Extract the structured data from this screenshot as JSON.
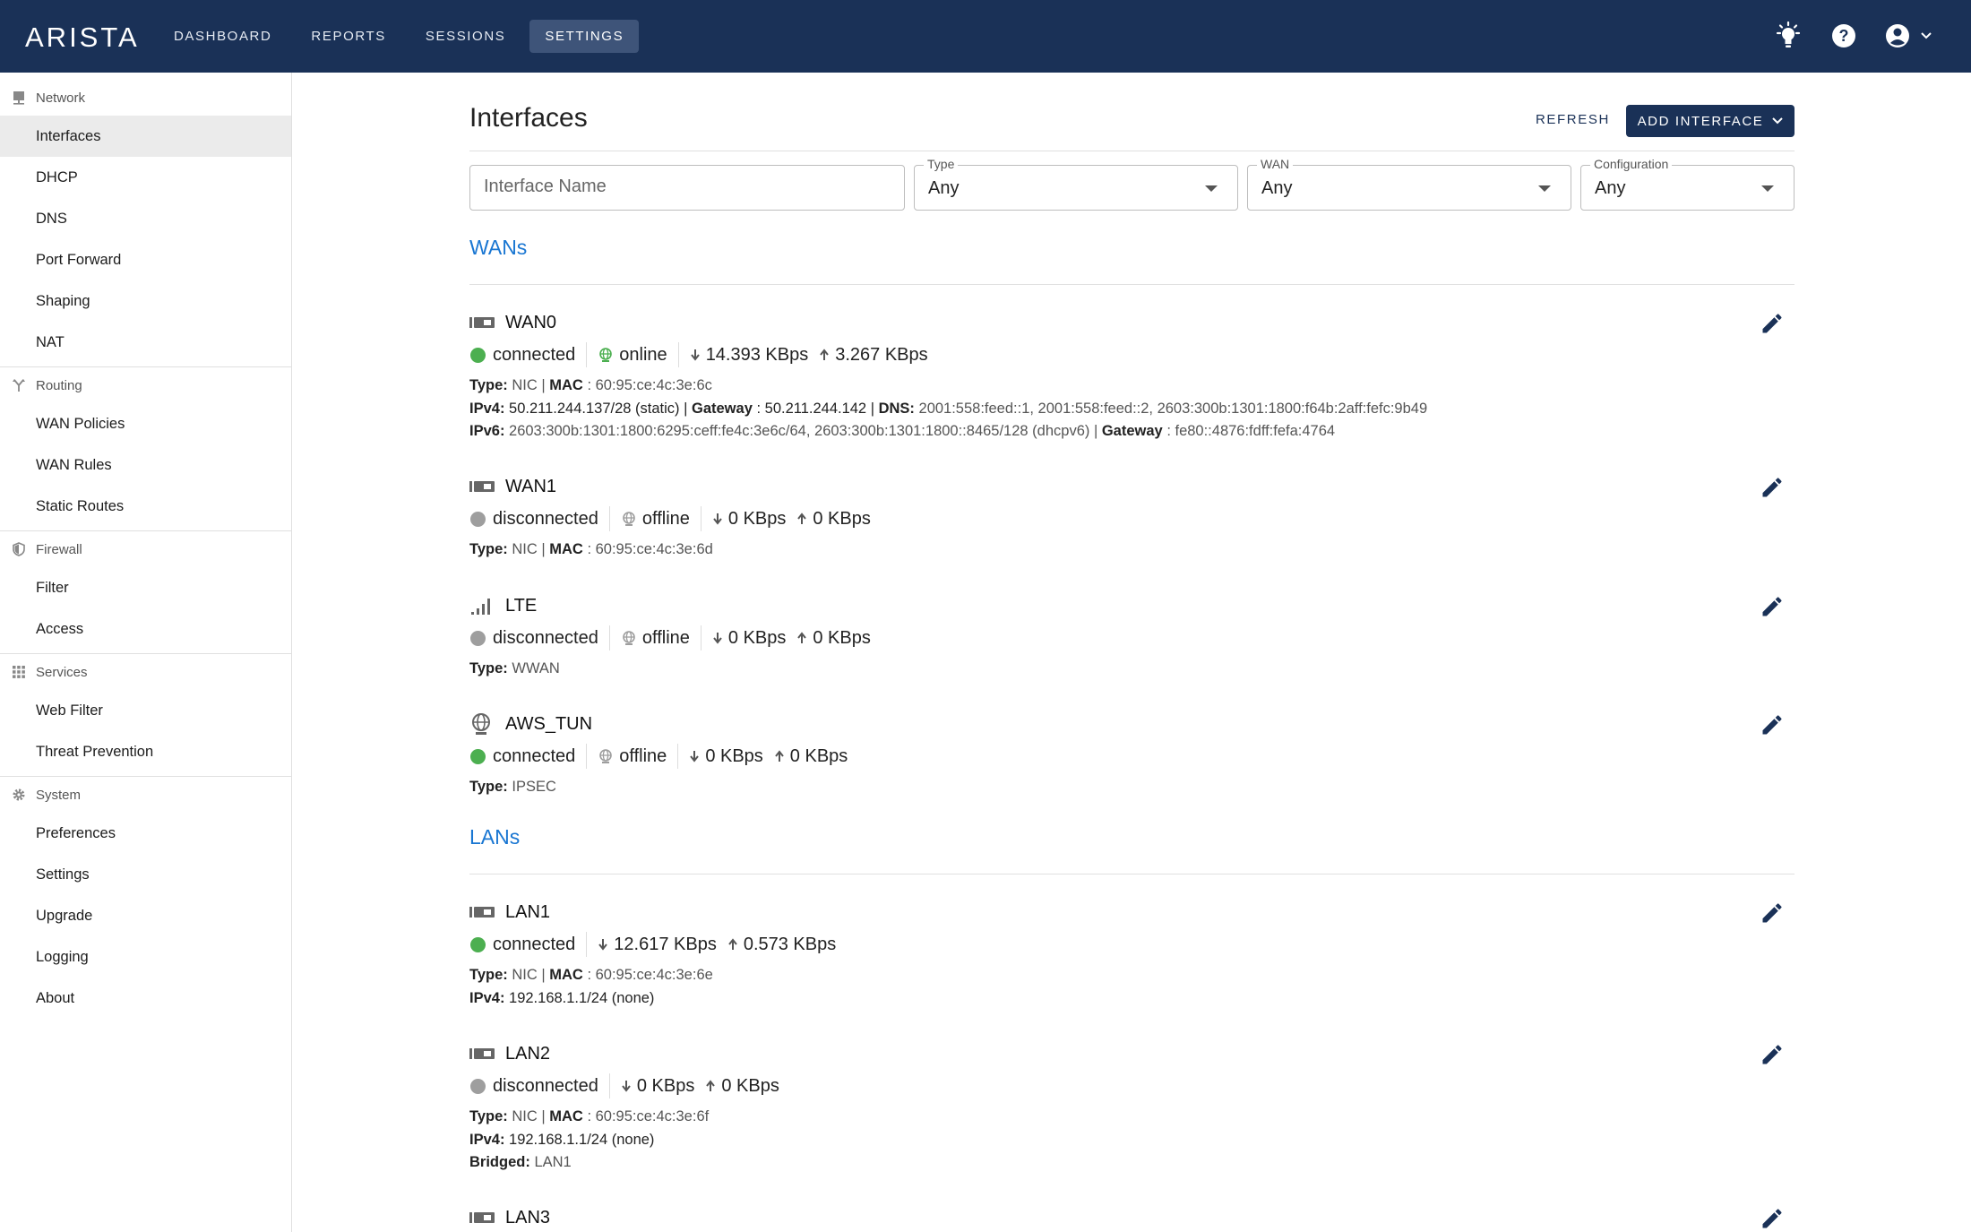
{
  "brand": "ARISTA",
  "nav": [
    "DASHBOARD",
    "REPORTS",
    "SESSIONS",
    "SETTINGS"
  ],
  "nav_active": "SETTINGS",
  "icons": {
    "theme": "lightbulb-icon",
    "help": "help-icon",
    "account": "account-circle-icon",
    "account_menu": "chevron-down-icon"
  },
  "sidebar": [
    {
      "section": "Network",
      "icon": "network-icon",
      "items": [
        "Interfaces",
        "DHCP",
        "DNS",
        "Port Forward",
        "Shaping",
        "NAT"
      ]
    },
    {
      "section": "Routing",
      "icon": "routing-icon",
      "items": [
        "WAN Policies",
        "WAN Rules",
        "Static Routes"
      ]
    },
    {
      "section": "Firewall",
      "icon": "shield-icon",
      "items": [
        "Filter",
        "Access"
      ]
    },
    {
      "section": "Services",
      "icon": "grid-icon",
      "items": [
        "Web Filter",
        "Threat Prevention"
      ]
    },
    {
      "section": "System",
      "icon": "gear-icon",
      "items": [
        "Preferences",
        "Settings",
        "Upgrade",
        "Logging",
        "About"
      ]
    }
  ],
  "page": {
    "title": "Interfaces",
    "refresh": "REFRESH",
    "add_interface": "ADD INTERFACE"
  },
  "filters": {
    "name_placeholder": "Interface Name",
    "type": {
      "label": "Type",
      "value": "Any"
    },
    "wan": {
      "label": "WAN",
      "value": "Any"
    },
    "configuration": {
      "label": "Configuration",
      "value": "Any"
    }
  },
  "groups": {
    "wans": "WANs",
    "lans": "LANs"
  },
  "wans": [
    {
      "name": "WAN0",
      "icon": "nic-icon",
      "status": "connected",
      "status_color": "#4caf50",
      "online": "online",
      "online_color": "#4caf50",
      "down": "14.393 KBps",
      "up": "3.267 KBps",
      "type_label": "Type:",
      "type": "NIC",
      "mac_label": "MAC",
      "mac": ": 60:95:ce:4c:3e:6c",
      "ipv4_label": "IPv4:",
      "ipv4": "50.211.244.137/28 (static) |",
      "gw4_label": "Gateway",
      "gw4": ": 50.211.244.142 |",
      "dns_label": "DNS:",
      "dns": "2001:558:feed::1, 2001:558:feed::2, 2603:300b:1301:1800:f64b:2aff:fefc:9b49",
      "ipv6_label": "IPv6:",
      "ipv6": "2603:300b:1301:1800:6295:ceff:fe4c:3e6c/64, 2603:300b:1301:1800::8465/128 (dhcpv6) |",
      "gw6_label": "Gateway",
      "gw6": ": fe80::4876:fdff:fefa:4764"
    },
    {
      "name": "WAN1",
      "icon": "nic-icon",
      "status": "disconnected",
      "status_color": "#9e9e9e",
      "online": "offline",
      "online_color": "#9e9e9e",
      "down": "0 KBps",
      "up": "0 KBps",
      "type_label": "Type:",
      "type": "NIC",
      "mac_label": "MAC",
      "mac": ": 60:95:ce:4c:3e:6d"
    },
    {
      "name": "LTE",
      "icon": "signal-bars-icon",
      "status": "disconnected",
      "status_color": "#9e9e9e",
      "online": "offline",
      "online_color": "#9e9e9e",
      "down": "0 KBps",
      "up": "0 KBps",
      "type_label": "Type:",
      "type": "WWAN"
    },
    {
      "name": "AWS_TUN",
      "icon": "globe-icon",
      "status": "connected",
      "status_color": "#4caf50",
      "online": "offline",
      "online_color": "#9e9e9e",
      "down": "0 KBps",
      "up": "0 KBps",
      "type_label": "Type:",
      "type": "IPSEC"
    }
  ],
  "lans": [
    {
      "name": "LAN1",
      "icon": "nic-icon",
      "status": "connected",
      "status_color": "#4caf50",
      "down": "12.617 KBps",
      "up": "0.573 KBps",
      "type_label": "Type:",
      "type": "NIC",
      "mac_label": "MAC",
      "mac": ": 60:95:ce:4c:3e:6e",
      "ipv4_label": "IPv4:",
      "ipv4": "192.168.1.1/24 (none)"
    },
    {
      "name": "LAN2",
      "icon": "nic-icon",
      "status": "disconnected",
      "status_color": "#9e9e9e",
      "down": "0 KBps",
      "up": "0 KBps",
      "type_label": "Type:",
      "type": "NIC",
      "mac_label": "MAC",
      "mac": ": 60:95:ce:4c:3e:6f",
      "ipv4_label": "IPv4:",
      "ipv4": "192.168.1.1/24 (none)",
      "bridged_label": "Bridged:",
      "bridged": "LAN1"
    },
    {
      "name": "LAN3",
      "icon": "nic-icon"
    }
  ]
}
